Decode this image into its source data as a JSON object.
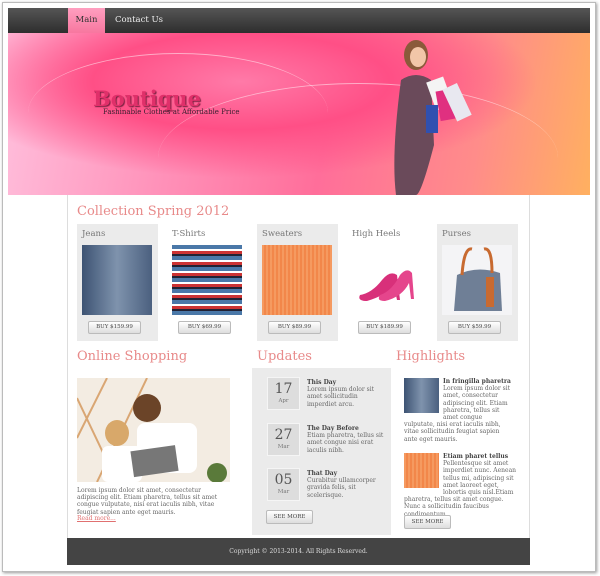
{
  "nav": {
    "items": [
      "Main",
      "Contact Us"
    ]
  },
  "banner": {
    "brand": "Boutique",
    "tagline": "Fashinable Clothes at Affordable Price"
  },
  "collection": {
    "title": "Collection Spring 2012",
    "products": [
      {
        "name": "Jeans",
        "button": "BUY $159.99"
      },
      {
        "name": "T-Shirts",
        "button": "BUY $69.99"
      },
      {
        "name": "Sweaters",
        "button": "BUY $89.99"
      },
      {
        "name": "High Heels",
        "button": "BUY $189.99"
      },
      {
        "name": "Purses",
        "button": "BUY $59.99"
      }
    ]
  },
  "online": {
    "title": "Online Shopping",
    "text": "Lorem ipsum dolor sit amet, consectetur adipiscing elit. Etiam pharetra, tellus sit amet congue vulputate, nisi erat iaculis nibh, vitae feugiat sapien ante eget mauris.",
    "link": "Read more..."
  },
  "updates": {
    "title": "Updates",
    "items": [
      {
        "day": "17",
        "month": "Apr",
        "heading": "This Day",
        "text": "Lorem ipsum dolor sit amet sollicitudin imperdiet arcu."
      },
      {
        "day": "27",
        "month": "Mar",
        "heading": "The Day Before",
        "text": "Etiam pharetra, tellus sit amet congue nisi erat iaculis nibh."
      },
      {
        "day": "05",
        "month": "Mar",
        "heading": "That Day",
        "text": "Curabitur ullamcorper gravida felis, sit scelerisque."
      }
    ],
    "button": "SEE MORE"
  },
  "highlights": {
    "title": "Highlights",
    "items": [
      {
        "heading": "In fringilla pharetra",
        "text": "Lorem ipsum dolor sit amet, consectetur adipiscing elit. Etiam pharetra, tellus sit amet congue vulputate, nisi erat iaculis nibh, vitae sollicitudin feugiat sapien ante eget mauris."
      },
      {
        "heading": "Etiam pharet tellus",
        "text": "Pellentesque sit amet imperdiet nunc. Aenean tellus mi, adipiscing sit amet laoreet eget, lobortis quis nisl.Etiam pharetra, tellus sit amet congue. Nunc a sollicitudin faucibus condimentum."
      }
    ],
    "button": "SEE MORE"
  },
  "footer": {
    "text": "Copyright © 2013-2014. All Rights Reserved."
  },
  "colors": {
    "accent": "#e88a8a",
    "nav_active": "#f7779f",
    "footer": "#444444",
    "brand": "#e0306a"
  }
}
